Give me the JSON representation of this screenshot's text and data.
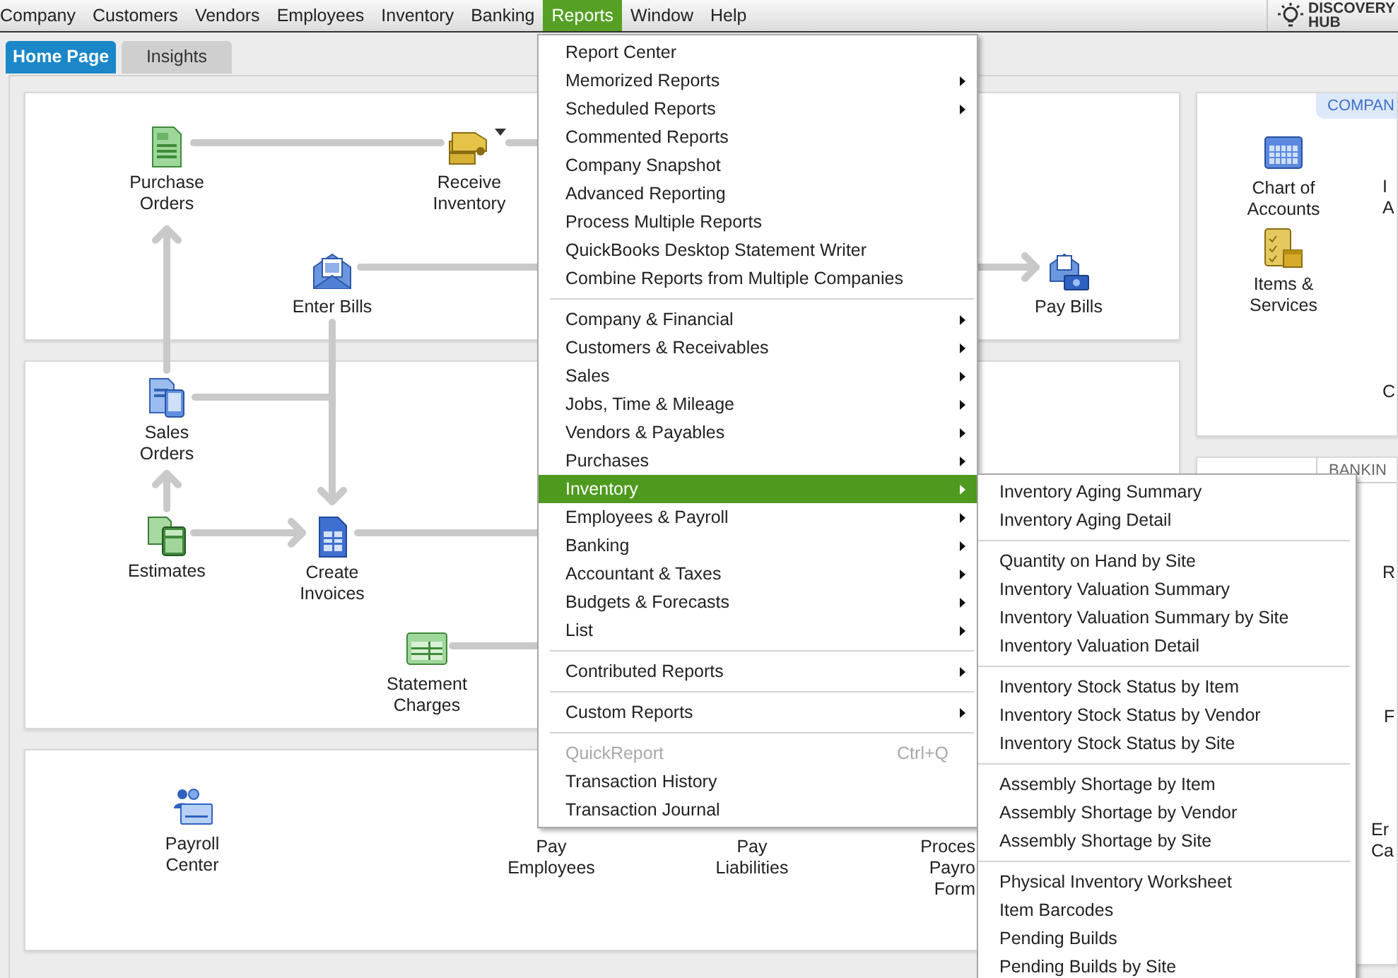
{
  "menu_bar": {
    "items": [
      {
        "label": "Company",
        "selected": false
      },
      {
        "label": "Customers",
        "selected": false
      },
      {
        "label": "Vendors",
        "selected": false
      },
      {
        "label": "Employees",
        "selected": false
      },
      {
        "label": "Inventory",
        "selected": false
      },
      {
        "label": "Banking",
        "selected": false
      },
      {
        "label": "Reports",
        "selected": true
      },
      {
        "label": "Window",
        "selected": false
      },
      {
        "label": "Help",
        "selected": false
      }
    ],
    "discovery_hub": {
      "label": "DISCOVERY\nHUB"
    }
  },
  "tabs": [
    {
      "label": "Home Page",
      "selected": true
    },
    {
      "label": "Insights",
      "selected": false
    }
  ],
  "panels": {
    "vendors": {
      "nodes": [
        {
          "label": "Purchase\nOrders",
          "kind": "purchase-order",
          "has_dropdown": false
        },
        {
          "label": "Receive\nInventory",
          "kind": "truck",
          "has_dropdown": true
        },
        {
          "label": "Enter Bills",
          "kind": "bill",
          "has_dropdown": false
        },
        {
          "label": "Pay Bills",
          "kind": "pay-bills",
          "has_dropdown": false
        }
      ]
    },
    "customers": {
      "nodes": [
        {
          "label": "Sales\nOrders",
          "kind": "sales-order"
        },
        {
          "label": "Estimates",
          "kind": "estimate"
        },
        {
          "label": "Create\nInvoices",
          "kind": "invoice"
        },
        {
          "label": "Statement\nCharges",
          "kind": "statement"
        }
      ]
    },
    "employees": {
      "nodes": [
        {
          "label": "Payroll\nCenter",
          "kind": "payroll"
        },
        {
          "label": "Pay\nEmployees"
        },
        {
          "label": "Pay\nLiabilities"
        },
        {
          "label": "Proces\nPayro\nForm"
        }
      ]
    },
    "company": {
      "header": "COMPAN",
      "nodes": [
        {
          "label": "Chart of\nAccounts",
          "kind": "chart-accounts"
        },
        {
          "label": "Items &\nServices",
          "kind": "items"
        },
        {
          "label": "I\nA"
        },
        {
          "label": "C"
        }
      ]
    },
    "banking": {
      "header": "BANKIN",
      "nodes": [
        {
          "label": "R"
        },
        {
          "label": "F"
        },
        {
          "label": "Er\nCa"
        }
      ]
    }
  },
  "reports_menu": {
    "groups": [
      [
        {
          "label": "Report Center",
          "submenu": false,
          "selected": false,
          "disabled": false
        },
        {
          "label": "Memorized Reports",
          "submenu": true,
          "selected": false,
          "disabled": false
        },
        {
          "label": "Scheduled Reports",
          "submenu": true,
          "selected": false,
          "disabled": false
        },
        {
          "label": "Commented Reports",
          "submenu": false,
          "selected": false,
          "disabled": false
        },
        {
          "label": "Company Snapshot",
          "submenu": false,
          "selected": false,
          "disabled": false
        },
        {
          "label": "Advanced Reporting",
          "submenu": false,
          "selected": false,
          "disabled": false
        },
        {
          "label": "Process Multiple Reports",
          "submenu": false,
          "selected": false,
          "disabled": false
        },
        {
          "label": "QuickBooks Desktop Statement Writer",
          "submenu": false,
          "selected": false,
          "disabled": false
        },
        {
          "label": "Combine Reports from Multiple Companies",
          "submenu": false,
          "selected": false,
          "disabled": false
        }
      ],
      [
        {
          "label": "Company & Financial",
          "submenu": true,
          "selected": false,
          "disabled": false
        },
        {
          "label": "Customers & Receivables",
          "submenu": true,
          "selected": false,
          "disabled": false
        },
        {
          "label": "Sales",
          "submenu": true,
          "selected": false,
          "disabled": false
        },
        {
          "label": "Jobs, Time & Mileage",
          "submenu": true,
          "selected": false,
          "disabled": false
        },
        {
          "label": "Vendors & Payables",
          "submenu": true,
          "selected": false,
          "disabled": false
        },
        {
          "label": "Purchases",
          "submenu": true,
          "selected": false,
          "disabled": false
        },
        {
          "label": "Inventory",
          "submenu": true,
          "selected": true,
          "disabled": false
        },
        {
          "label": "Employees & Payroll",
          "submenu": true,
          "selected": false,
          "disabled": false
        },
        {
          "label": "Banking",
          "submenu": true,
          "selected": false,
          "disabled": false
        },
        {
          "label": "Accountant & Taxes",
          "submenu": true,
          "selected": false,
          "disabled": false
        },
        {
          "label": "Budgets & Forecasts",
          "submenu": true,
          "selected": false,
          "disabled": false
        },
        {
          "label": "List",
          "submenu": true,
          "selected": false,
          "disabled": false
        }
      ],
      [
        {
          "label": "Contributed Reports",
          "submenu": true,
          "selected": false,
          "disabled": false
        }
      ],
      [
        {
          "label": "Custom Reports",
          "submenu": true,
          "selected": false,
          "disabled": false
        }
      ],
      [
        {
          "label": "QuickReport",
          "shortcut": "Ctrl+Q",
          "submenu": false,
          "selected": false,
          "disabled": true
        },
        {
          "label": "Transaction History",
          "submenu": false,
          "selected": false,
          "disabled": false
        },
        {
          "label": "Transaction Journal",
          "submenu": false,
          "selected": false,
          "disabled": false
        }
      ]
    ]
  },
  "inventory_submenu": {
    "groups": [
      [
        {
          "label": "Inventory Aging Summary",
          "selected": false
        },
        {
          "label": "Inventory Aging Detail",
          "selected": false
        }
      ],
      [
        {
          "label": "Quantity on Hand by Site",
          "selected": false
        },
        {
          "label": "Inventory Valuation Summary",
          "selected": false
        },
        {
          "label": "Inventory Valuation Summary by Site",
          "selected": false
        },
        {
          "label": "Inventory Valuation Detail",
          "selected": false
        }
      ],
      [
        {
          "label": "Inventory Stock Status by Item",
          "selected": false
        },
        {
          "label": "Inventory Stock Status by Vendor",
          "selected": false
        },
        {
          "label": "Inventory Stock Status by Site",
          "selected": false
        }
      ],
      [
        {
          "label": "Assembly Shortage by Item",
          "selected": false
        },
        {
          "label": "Assembly Shortage by Vendor",
          "selected": false
        },
        {
          "label": "Assembly Shortage by Site",
          "selected": false
        }
      ],
      [
        {
          "label": "Physical Inventory Worksheet",
          "selected": false
        },
        {
          "label": "Item Barcodes",
          "selected": false
        },
        {
          "label": "Pending Builds",
          "selected": false
        },
        {
          "label": "Pending Builds by Site",
          "selected": false
        }
      ]
    ]
  }
}
